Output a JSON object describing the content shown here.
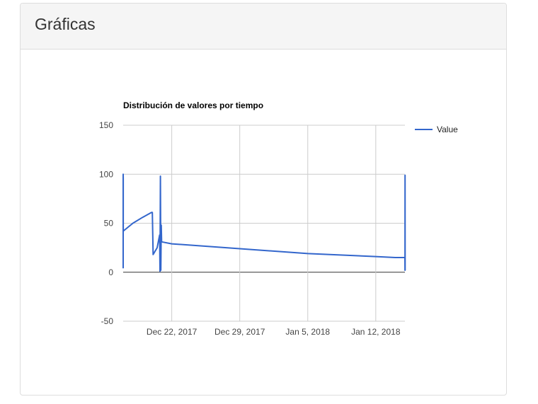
{
  "panel": {
    "title": "Gráficas"
  },
  "chart_data": {
    "type": "line",
    "title": "Distribución de valores por tiempo",
    "xlabel": "",
    "ylabel": "",
    "ylim": [
      -50,
      150
    ],
    "y_ticks": [
      150,
      100,
      50,
      0,
      -50
    ],
    "x_range": [
      "2017-12-17",
      "2018-01-15"
    ],
    "x_ticks": [
      {
        "date": "2017-12-22",
        "label": "Dec 22, 2017"
      },
      {
        "date": "2017-12-29",
        "label": "Dec 29, 2017"
      },
      {
        "date": "2018-01-05",
        "label": "Jan 5, 2018"
      },
      {
        "date": "2018-01-12",
        "label": "Jan 12, 2018"
      }
    ],
    "grid": true,
    "legend": "right",
    "series": [
      {
        "name": "Value",
        "color": "#3366cc",
        "points": [
          [
            "2017-12-17 00:00",
            4
          ],
          [
            "2017-12-17 00:05",
            100
          ],
          [
            "2017-12-17 00:10",
            95
          ],
          [
            "2017-12-17 00:15",
            42
          ],
          [
            "2017-12-18 00:00",
            50
          ],
          [
            "2017-12-19 00:00",
            56
          ],
          [
            "2017-12-19 22:00",
            61
          ],
          [
            "2017-12-20 00:00",
            61
          ],
          [
            "2017-12-20 02:00",
            18
          ],
          [
            "2017-12-20 12:00",
            25
          ],
          [
            "2017-12-20 18:00",
            38
          ],
          [
            "2017-12-20 19:00",
            1
          ],
          [
            "2017-12-20 20:00",
            98
          ],
          [
            "2017-12-20 21:00",
            2
          ],
          [
            "2017-12-20 22:00",
            48
          ],
          [
            "2017-12-20 23:00",
            31
          ],
          [
            "2017-12-22 00:00",
            29
          ],
          [
            "2017-12-29 00:00",
            24
          ],
          [
            "2018-01-05 00:00",
            19
          ],
          [
            "2018-01-12 00:00",
            16
          ],
          [
            "2018-01-14 00:00",
            15
          ],
          [
            "2018-01-15 00:00",
            15
          ],
          [
            "2018-01-15 00:10",
            2
          ],
          [
            "2018-01-15 00:20",
            99
          ],
          [
            "2018-01-15 00:30",
            2
          ]
        ]
      }
    ]
  }
}
